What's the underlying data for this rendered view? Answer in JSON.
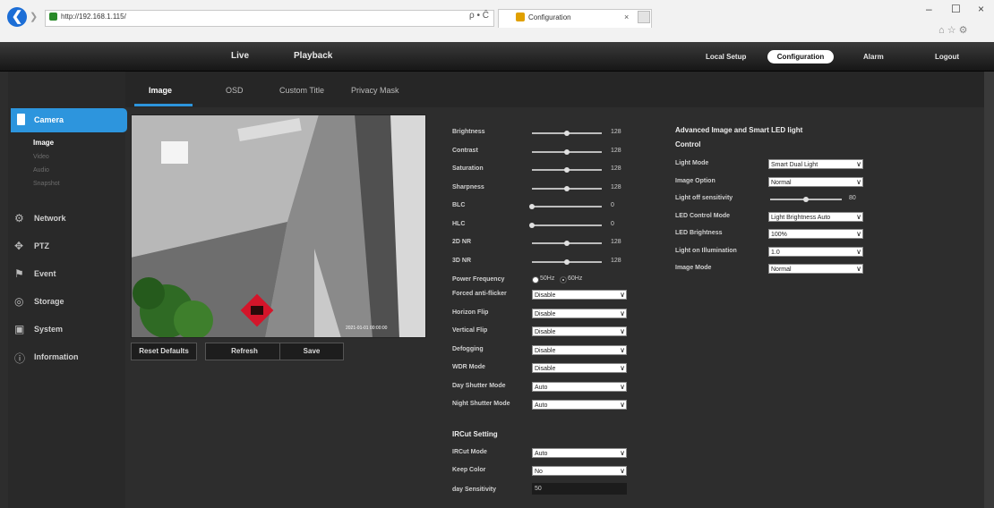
{
  "browser": {
    "url": "http://192.168.1.115/",
    "addr_tools": "ρ • Ĉ",
    "tab_title": "Configuration",
    "tab_close": "×",
    "win_min": "–",
    "win_max": "☐",
    "win_close": "×",
    "tray": "⌂ ☆ ⚙"
  },
  "topnav": {
    "live": "Live",
    "playback": "Playback",
    "local_setup": "Local Setup",
    "configuration": "Configuration",
    "alarm": "Alarm",
    "logout": "Logout"
  },
  "sidebar": {
    "camera": "Camera",
    "camera_sub": [
      "Image",
      "Video",
      "Audio",
      "Snapshot"
    ],
    "items": [
      {
        "label": "Network",
        "icon": "network-icon"
      },
      {
        "label": "PTZ",
        "icon": "ptz-icon"
      },
      {
        "label": "Event",
        "icon": "event-icon"
      },
      {
        "label": "Storage",
        "icon": "storage-icon"
      },
      {
        "label": "System",
        "icon": "system-icon"
      },
      {
        "label": "Information",
        "icon": "information-icon"
      }
    ]
  },
  "subtabs": [
    "Image",
    "OSD",
    "Custom Title",
    "Privacy Mask"
  ],
  "video": {
    "overlay_time": "2021-01-01 00:00:00"
  },
  "buttons": {
    "reset": "Reset Defaults",
    "refresh": "Refresh",
    "save": "Save"
  },
  "sliders": [
    {
      "label": "Brightness",
      "value": "128",
      "fraction": 0.5
    },
    {
      "label": "Contrast",
      "value": "128",
      "fraction": 0.5
    },
    {
      "label": "Saturation",
      "value": "128",
      "fraction": 0.5
    },
    {
      "label": "Sharpness",
      "value": "128",
      "fraction": 0.5
    },
    {
      "label": "BLC",
      "value": "0",
      "fraction": 0.0
    },
    {
      "label": "HLC",
      "value": "0",
      "fraction": 0.0
    },
    {
      "label": "2D NR",
      "value": "128",
      "fraction": 0.5
    },
    {
      "label": "3D NR",
      "value": "128",
      "fraction": 0.5
    }
  ],
  "power_frequency": {
    "label": "Power Frequency",
    "opt1": "50Hz",
    "opt2": "60Hz",
    "selected": "60Hz"
  },
  "selects_left": [
    {
      "label": "Forced anti-flicker",
      "value": "Disable"
    },
    {
      "label": "Horizon Flip",
      "value": "Disable"
    },
    {
      "label": "Vertical Flip",
      "value": "Disable"
    },
    {
      "label": "Defogging",
      "value": "Disable"
    },
    {
      "label": "WDR Mode",
      "value": "Disable"
    },
    {
      "label": "Day Shutter Mode",
      "value": "Auto"
    },
    {
      "label": "Night Shutter Mode",
      "value": "Auto"
    }
  ],
  "ircut": {
    "header": "IRCut Setting",
    "rows": [
      {
        "label": "IRCut Mode",
        "value": "Auto"
      },
      {
        "label": "Keep Color",
        "value": "No"
      }
    ],
    "day_sensitivity_label": "day Sensitivity",
    "day_sensitivity_value": "50"
  },
  "advanced": {
    "header_line1": "Advanced Image and Smart LED light",
    "header_line2": "Control",
    "rows": [
      {
        "label": "Light Mode",
        "type": "select",
        "value": "Smart Dual Light"
      },
      {
        "label": "Image Option",
        "type": "select",
        "value": "Normal"
      },
      {
        "label": "Light off sensitivity",
        "type": "slider",
        "value": "80",
        "fraction": 0.5
      },
      {
        "label": "LED Control Mode",
        "type": "select",
        "value": "Light Brightness Auto"
      },
      {
        "label": "LED Brightness",
        "type": "select",
        "value": "100%"
      },
      {
        "label": "Light on Illumination",
        "type": "select",
        "value": "1.0"
      },
      {
        "label": "Image Mode",
        "type": "select",
        "value": "Normal"
      }
    ]
  }
}
